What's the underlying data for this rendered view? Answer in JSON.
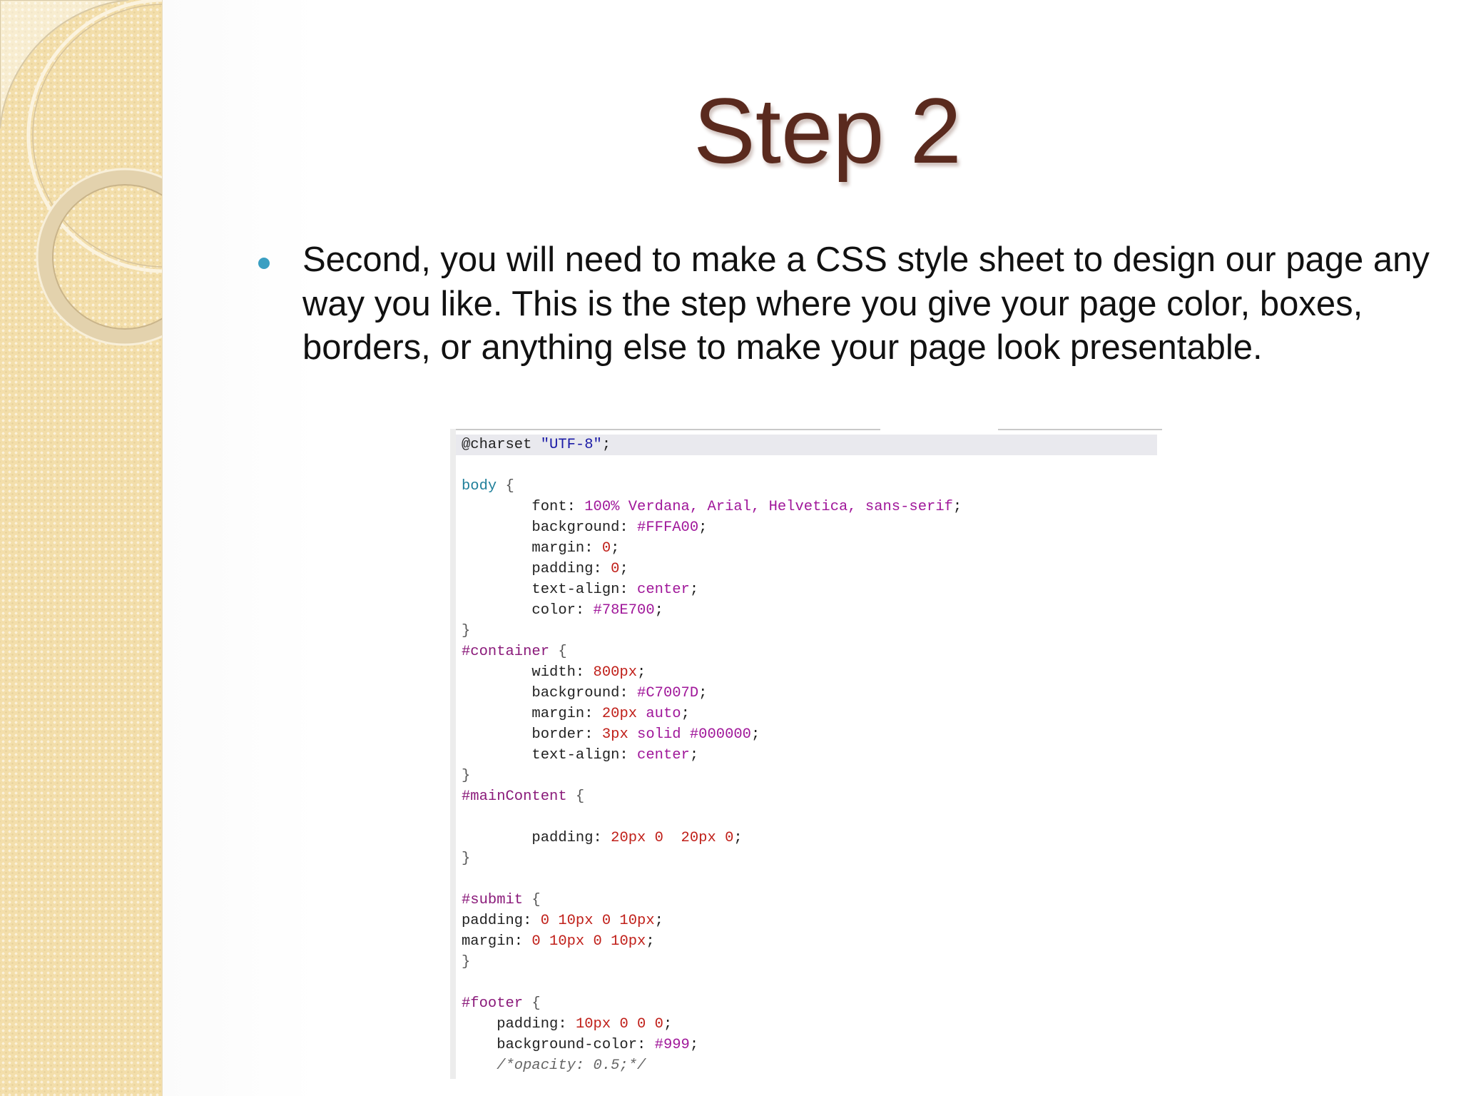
{
  "slide": {
    "title": "Step 2",
    "bullet": "Second, you will need to make a CSS style sheet to design our page any way you like. This is the step where you give your page color, boxes, borders, or anything else to make your page look presentable."
  },
  "colors": {
    "title": "#5a2a1e",
    "bullet": "#3a9fc2",
    "side_strip": "#f3deaa"
  },
  "code": {
    "lines": [
      [
        {
          "t": "@charset ",
          "c": "prop"
        },
        {
          "t": "\"UTF-8\"",
          "c": "str"
        },
        {
          "t": ";",
          "c": "prop"
        }
      ],
      [],
      [
        {
          "t": "body",
          "c": "sel"
        },
        {
          "t": " {",
          "c": "brace"
        }
      ],
      [
        {
          "t": "        font: ",
          "c": "prop"
        },
        {
          "t": "100% Verdana, Arial, Helvetica, sans-serif",
          "c": "val"
        },
        {
          "t": ";",
          "c": "prop"
        }
      ],
      [
        {
          "t": "        background: ",
          "c": "prop"
        },
        {
          "t": "#FFFA00",
          "c": "val"
        },
        {
          "t": ";",
          "c": "prop"
        }
      ],
      [
        {
          "t": "        margin: ",
          "c": "prop"
        },
        {
          "t": "0",
          "c": "num"
        },
        {
          "t": ";",
          "c": "prop"
        }
      ],
      [
        {
          "t": "        padding: ",
          "c": "prop"
        },
        {
          "t": "0",
          "c": "num"
        },
        {
          "t": ";",
          "c": "prop"
        }
      ],
      [
        {
          "t": "        text-align: ",
          "c": "prop"
        },
        {
          "t": "center",
          "c": "val"
        },
        {
          "t": ";",
          "c": "prop"
        }
      ],
      [
        {
          "t": "        color: ",
          "c": "prop"
        },
        {
          "t": "#78E700",
          "c": "val"
        },
        {
          "t": ";",
          "c": "prop"
        }
      ],
      [
        {
          "t": "}",
          "c": "brace"
        }
      ],
      [
        {
          "t": "#container",
          "c": "id"
        },
        {
          "t": " {",
          "c": "brace"
        }
      ],
      [
        {
          "t": "        width: ",
          "c": "prop"
        },
        {
          "t": "800px",
          "c": "num"
        },
        {
          "t": ";",
          "c": "prop"
        }
      ],
      [
        {
          "t": "        background: ",
          "c": "prop"
        },
        {
          "t": "#C7007D",
          "c": "val"
        },
        {
          "t": ";",
          "c": "prop"
        }
      ],
      [
        {
          "t": "        margin: ",
          "c": "prop"
        },
        {
          "t": "20px",
          "c": "num"
        },
        {
          "t": " auto",
          "c": "val"
        },
        {
          "t": ";",
          "c": "prop"
        }
      ],
      [
        {
          "t": "        border: ",
          "c": "prop"
        },
        {
          "t": "3px",
          "c": "num"
        },
        {
          "t": " solid #000000",
          "c": "val"
        },
        {
          "t": ";",
          "c": "prop"
        }
      ],
      [
        {
          "t": "        text-align: ",
          "c": "prop"
        },
        {
          "t": "center",
          "c": "val"
        },
        {
          "t": ";",
          "c": "prop"
        }
      ],
      [
        {
          "t": "}",
          "c": "brace"
        }
      ],
      [
        {
          "t": "#mainContent",
          "c": "id"
        },
        {
          "t": " {",
          "c": "brace"
        }
      ],
      [],
      [
        {
          "t": "        padding: ",
          "c": "prop"
        },
        {
          "t": "20px 0  20px 0",
          "c": "num"
        },
        {
          "t": ";",
          "c": "prop"
        }
      ],
      [
        {
          "t": "}",
          "c": "brace"
        }
      ],
      [],
      [
        {
          "t": "#submit",
          "c": "id"
        },
        {
          "t": " {",
          "c": "brace"
        }
      ],
      [
        {
          "t": "padding: ",
          "c": "prop"
        },
        {
          "t": "0 10px 0 10px",
          "c": "num"
        },
        {
          "t": ";",
          "c": "prop"
        }
      ],
      [
        {
          "t": "margin: ",
          "c": "prop"
        },
        {
          "t": "0 10px 0 10px",
          "c": "num"
        },
        {
          "t": ";",
          "c": "prop"
        }
      ],
      [
        {
          "t": "}",
          "c": "brace"
        }
      ],
      [],
      [
        {
          "t": "#footer",
          "c": "id"
        },
        {
          "t": " {",
          "c": "brace"
        }
      ],
      [
        {
          "t": "    padding: ",
          "c": "prop"
        },
        {
          "t": "10px 0 0 0",
          "c": "num"
        },
        {
          "t": ";",
          "c": "prop"
        }
      ],
      [
        {
          "t": "    background-color: ",
          "c": "prop"
        },
        {
          "t": "#999",
          "c": "val"
        },
        {
          "t": ";",
          "c": "prop"
        }
      ],
      [
        {
          "t": "    /*opacity: 0.5;*/",
          "c": "cmt"
        }
      ]
    ]
  }
}
